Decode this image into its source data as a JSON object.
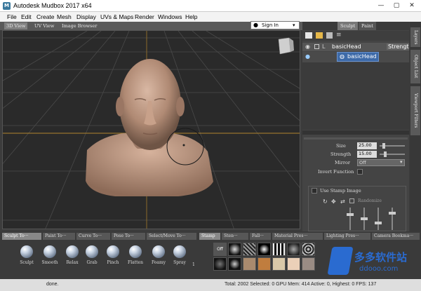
{
  "title_bar": {
    "app_icon": "M",
    "title": "Autodesk Mudbox 2017 x64"
  },
  "menu": [
    "File",
    "Edit",
    "Create",
    "Mesh",
    "Display",
    "UVs & Maps",
    "Render",
    "Windows",
    "Help"
  ],
  "viewport_tabs": [
    "3D View",
    "UV View",
    "Image Browser"
  ],
  "sign_in": {
    "label": "Sign In"
  },
  "right_panel": {
    "tabs": [
      "Sculpt",
      "Paint"
    ],
    "layer_header": "basicHead",
    "layer_column": "Strength",
    "layer_item": "basicHead",
    "properties": {
      "size_label": "Size",
      "size_value": "25.00",
      "strength_label": "Strength",
      "strength_value": "15.00",
      "mirror_label": "Mirror",
      "mirror_value": "Off",
      "invert_label": "Invert Function",
      "stamp_label": "Use Stamp Image",
      "randomize_label": "Randomize"
    }
  },
  "side_tabs": [
    "Layers",
    "Object List",
    "Viewport Filters"
  ],
  "tray": {
    "tabs": [
      "Sculpt To···",
      "Paint To···",
      "Curve To···",
      "Pose To···",
      "Select/Move To···",
      "Stamp",
      "Sten···",
      "Fall···",
      "Material Pres···",
      "Lighting Pres···",
      "Camera Bookma···"
    ],
    "tools": [
      "Sculpt",
      "Smooth",
      "Relax",
      "Grab",
      "Pinch",
      "Flatten",
      "Foamy",
      "Spray"
    ],
    "tools_more": "1",
    "stamp_off": "Off"
  },
  "status": {
    "left": "done.",
    "right": "Total: 2002  Selected: 0 GPU Mem: 414  Active: 0, Highest: 0  FPS: 137"
  },
  "watermark": {
    "brand": "多多软件站",
    "url": "ddooo.com"
  },
  "colors": {
    "accent": "#3d6aa8",
    "viewport_bg": "#2a2a2a",
    "head_skin": "#b8907a"
  }
}
